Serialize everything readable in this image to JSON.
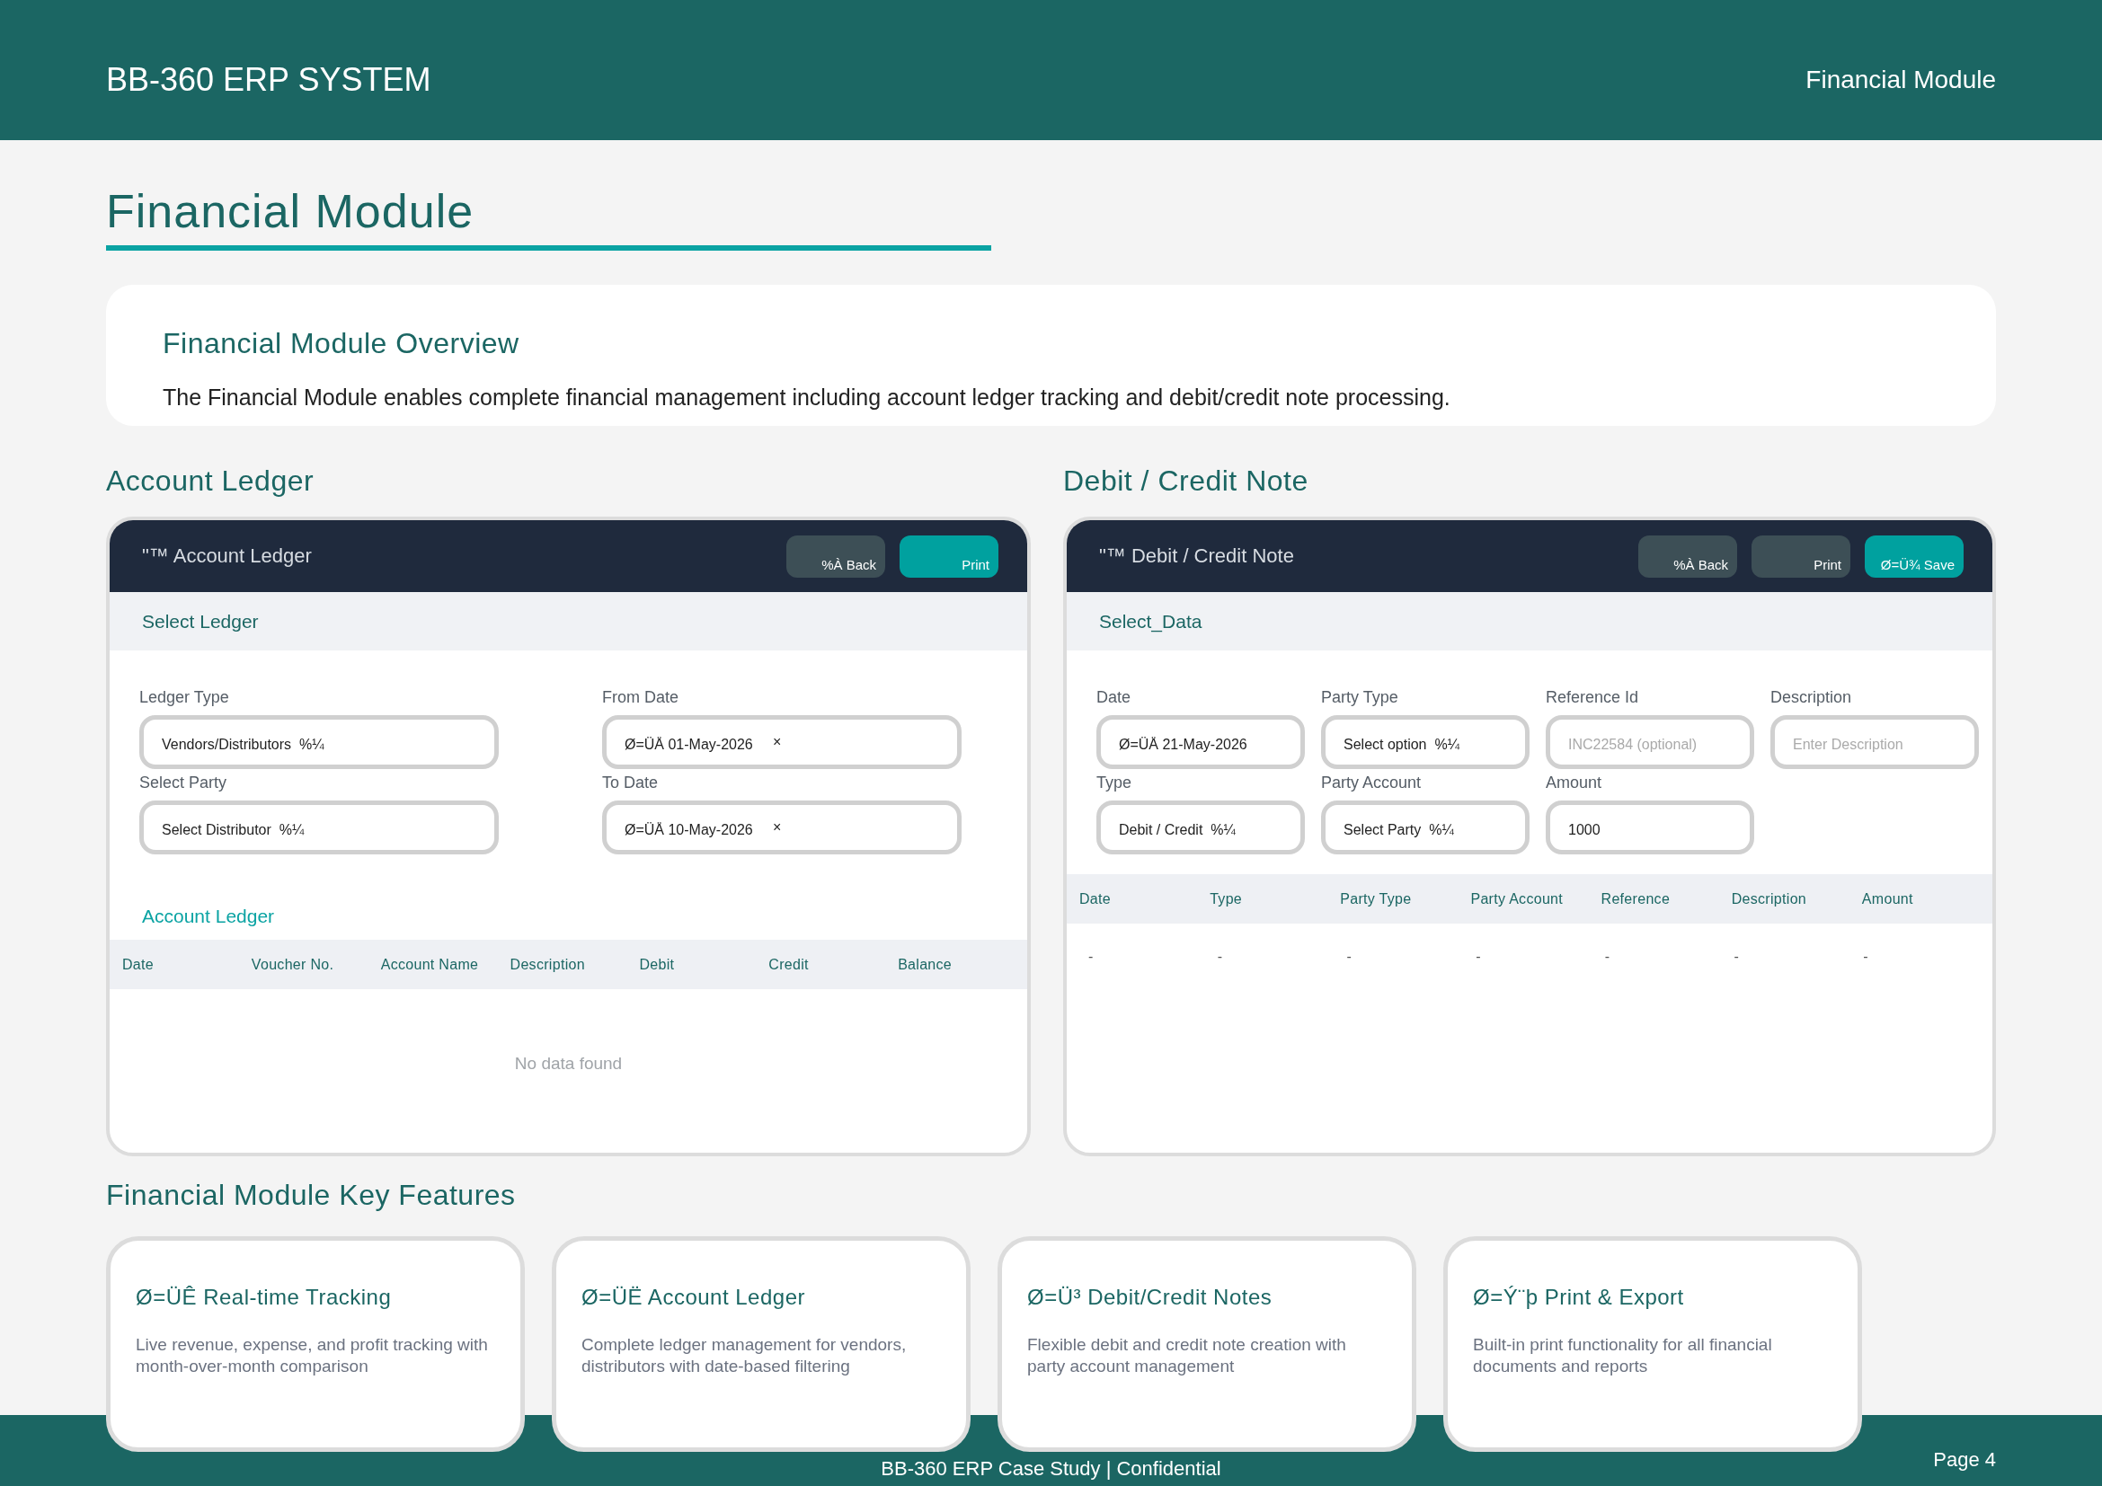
{
  "header": {
    "title": "BB-360 ERP SYSTEM",
    "module": "Financial Module"
  },
  "page_title": "Financial Module",
  "overview": {
    "title": "Financial Module Overview",
    "text": "The Financial Module enables complete financial management including account ledger tracking and debit/credit note processing."
  },
  "panels": [
    {
      "section_title": "Account Ledger",
      "title": "\"™ Account Ledger",
      "buttons": [
        {
          "label": "%À Back",
          "kind": "secondary"
        },
        {
          "label": "Print",
          "kind": "primary"
        }
      ],
      "band": "Select Ledger",
      "fields": [
        {
          "label": "Ledger Type",
          "value": "Vendors/Distributors  %¼"
        },
        {
          "label": "From Date",
          "value": "Ø=ÜÅ 01-May-2026",
          "clear": "×"
        },
        {
          "label": "Select Party",
          "value": "Select Distributor  %¼"
        },
        {
          "label": "To Date",
          "value": "Ø=ÜÅ 10-May-2026",
          "clear": "×"
        }
      ],
      "table": {
        "title": "Account Ledger",
        "columns": [
          "Date",
          "Voucher No.",
          "Account Name",
          "Description",
          "Debit",
          "Credit",
          "Balance"
        ],
        "empty": "No data found"
      }
    },
    {
      "section_title": "Debit / Credit Note",
      "title": "\"™ Debit / Credit Note",
      "buttons": [
        {
          "label": "%À Back",
          "kind": "secondary"
        },
        {
          "label": "Print",
          "kind": "secondary"
        },
        {
          "label": "Ø=Ü¾ Save",
          "kind": "primary"
        }
      ],
      "band": "Select_Data",
      "fields": [
        {
          "label": "Date",
          "value": "Ø=ÜÅ 21-May-2026"
        },
        {
          "label": "Party Type",
          "value": "Select option  %¼"
        },
        {
          "label": "Reference Id",
          "placeholder": "INC22584 (optional)"
        },
        {
          "label": "Description",
          "placeholder": "Enter Description"
        },
        {
          "label": "Type",
          "value": "Debit / Credit  %¼"
        },
        {
          "label": "Party Account",
          "value": "Select Party  %¼"
        },
        {
          "label": "Amount",
          "value": "1000"
        }
      ],
      "table": {
        "columns": [
          "Date",
          "Type",
          "Party Type",
          "Party Account",
          "Reference",
          "Description",
          "Amount"
        ],
        "rows": [
          [
            "-",
            "-",
            "-",
            "-",
            "-",
            "-",
            "-"
          ]
        ]
      }
    }
  ],
  "features": {
    "title": "Financial Module Key Features",
    "cards": [
      {
        "title": "Ø=ÜÊ Real-time Tracking",
        "text": "Live revenue, expense, and profit tracking with month-over-month comparison"
      },
      {
        "title": "Ø=ÜË Account Ledger",
        "text": "Complete ledger management for vendors, distributors with date-based filtering"
      },
      {
        "title": "Ø=Ü³ Debit/Credit Notes",
        "text": "Flexible debit and credit note creation with party account management"
      },
      {
        "title": "Ø=Ý¨þ Print & Export",
        "text": "Built-in print functionality for all financial documents and reports"
      }
    ]
  },
  "footer": {
    "text": "BB-360 ERP Case Study | Confidential",
    "page": "Page 4"
  }
}
